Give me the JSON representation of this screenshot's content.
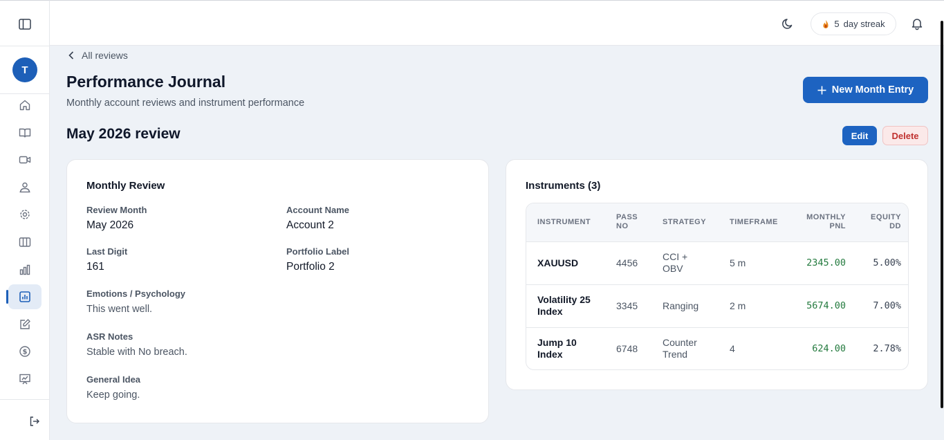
{
  "topbar": {
    "streak_count": "5",
    "streak_label": "day streak"
  },
  "sidebar": {
    "avatar_initial": "T",
    "items": [
      {
        "icon": "home-icon"
      },
      {
        "icon": "book-icon"
      },
      {
        "icon": "video-icon"
      },
      {
        "icon": "users-icon"
      },
      {
        "icon": "gear-icon"
      },
      {
        "icon": "columns-icon"
      },
      {
        "icon": "bar-chart-icon"
      },
      {
        "icon": "chart-report-icon",
        "active": true
      },
      {
        "icon": "edit-icon"
      },
      {
        "icon": "dollar-icon"
      },
      {
        "icon": "presentation-icon"
      }
    ]
  },
  "breadcrumb": {
    "back_label": "All reviews"
  },
  "header": {
    "title": "Performance Journal",
    "subtitle": "Monthly account reviews and instrument performance",
    "new_entry_label": "New Month Entry"
  },
  "review": {
    "title": "May 2026 review",
    "edit_label": "Edit",
    "delete_label": "Delete"
  },
  "monthly_review": {
    "title": "Monthly Review",
    "review_month_label": "Review Month",
    "review_month": "May 2026",
    "account_name_label": "Account Name",
    "account_name": "Account 2",
    "last_digit_label": "Last Digit",
    "last_digit": "161",
    "portfolio_label_label": "Portfolio Label",
    "portfolio_label": "Portfolio 2",
    "emotions_label": "Emotions / Psychology",
    "emotions": "This went well.",
    "asr_label": "ASR Notes",
    "asr": "Stable with No breach.",
    "idea_label": "General Idea",
    "idea": "Keep going."
  },
  "instruments": {
    "title": "Instruments (3)",
    "columns": [
      "INSTRUMENT",
      "PASS NO",
      "STRATEGY",
      "TIMEFRAME",
      "MONTHLY PNL",
      "EQUITY DD"
    ],
    "rows": [
      {
        "instrument": "XAUUSD",
        "pass_no": "4456",
        "strategy": "CCI + OBV",
        "timeframe": "5 m",
        "pnl": "2345.00",
        "dd": "5.00%"
      },
      {
        "instrument": "Volatility 25 Index",
        "pass_no": "3345",
        "strategy": "Ranging",
        "timeframe": "2 m",
        "pnl": "5674.00",
        "dd": "7.00%"
      },
      {
        "instrument": "Jump 10 Index",
        "pass_no": "6748",
        "strategy": "Counter Trend",
        "timeframe": "4",
        "pnl": "624.00",
        "dd": "2.78%"
      }
    ]
  },
  "colors": {
    "primary": "#1d63c1",
    "danger": "#c0312f",
    "positive": "#237a3e"
  }
}
